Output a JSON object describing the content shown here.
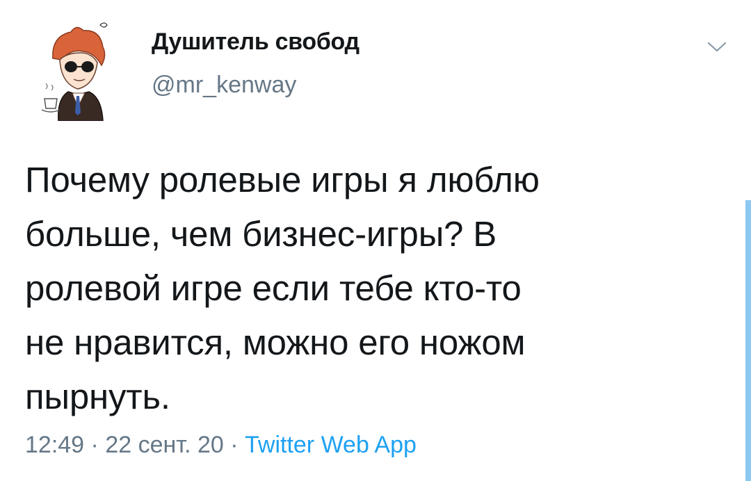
{
  "author": {
    "display_name": "Душитель свобод",
    "handle": "@mr_kenway"
  },
  "tweet": {
    "text": "Почему ролевые игры я люблю\nбольше, чем бизнес-игры? В\nролевой игре если тебе кто-то\nне нравится, можно его ножом\nпырнуть.",
    "time": "12:49",
    "date": "22 сент. 20",
    "separator": " · ",
    "source": "Twitter Web App"
  },
  "icons": {
    "menu": "chevron-down-icon"
  },
  "colors": {
    "text": "#14171a",
    "secondary": "#657786",
    "accent": "#1da1f2"
  }
}
